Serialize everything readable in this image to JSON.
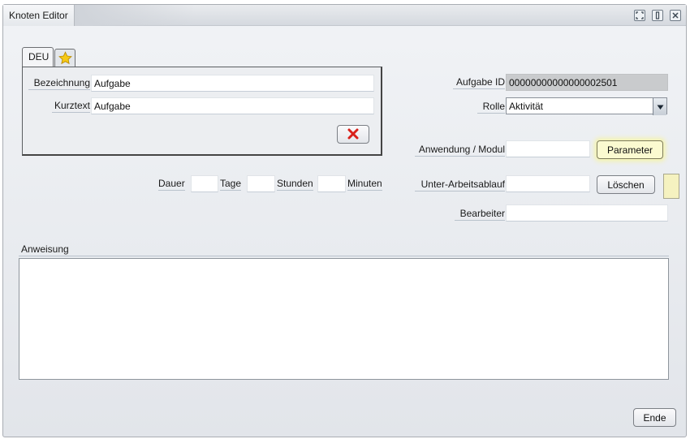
{
  "window": {
    "title": "Knoten Editor"
  },
  "language_tabs": {
    "active": "DEU",
    "favorites_icon": "star-icon"
  },
  "name_fields": {
    "bezeichnung_label": "Bezeichnung",
    "bezeichnung_value": "Aufgabe",
    "kurztext_label": "Kurztext",
    "kurztext_value": "Aufgabe",
    "delete_icon": "red-x-icon"
  },
  "duration": {
    "label": "Dauer",
    "days_unit": "Tage",
    "hours_unit": "Stunden",
    "minutes_unit": "Minuten",
    "days_value": "",
    "hours_value": "",
    "minutes_value": ""
  },
  "task": {
    "id_label": "Aufgabe ID",
    "id_value": "00000000000000002501",
    "role_label": "Rolle",
    "role_value": "Aktivität",
    "application_label": "Anwendung / Modul",
    "application_value": "",
    "parameter_button": "Parameter",
    "subworkflow_label": "Unter-Arbeitsablauf",
    "subworkflow_value": "",
    "delete_button": "Löschen",
    "editor_label": "Bearbeiter",
    "editor_value": ""
  },
  "instruction": {
    "label": "Anweisung",
    "value": ""
  },
  "footer": {
    "end_button": "Ende"
  },
  "colors": {
    "highlight_button": "#fbfad0",
    "readonly_field": "#c9cbcd",
    "swatch": "#f5f2c0",
    "delete_x": "#d9211b"
  }
}
